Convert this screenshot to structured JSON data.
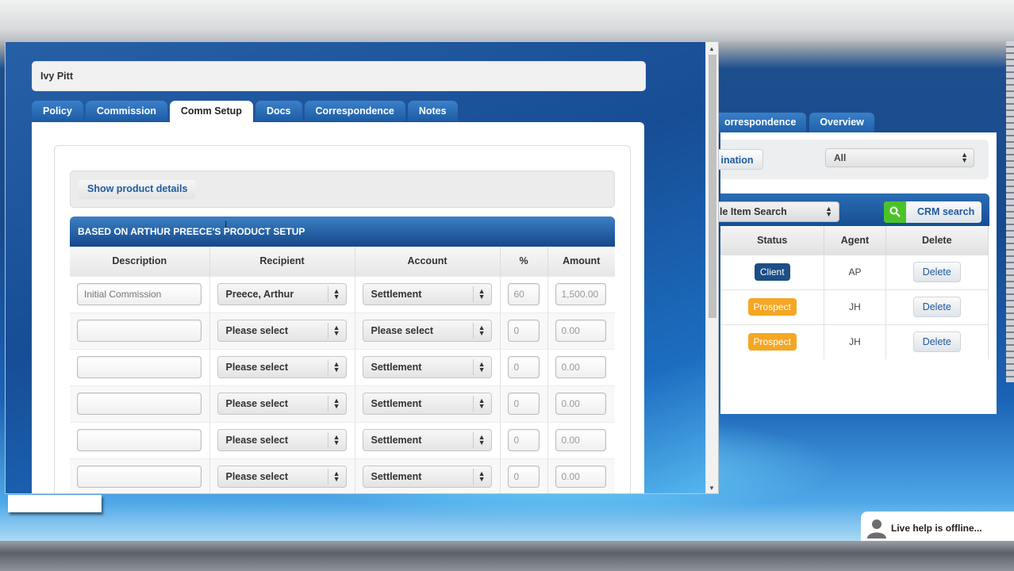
{
  "client_name": "Ivy Pitt",
  "tabs": [
    {
      "label": "Policy",
      "active": false
    },
    {
      "label": "Commission",
      "active": false
    },
    {
      "label": "Comm Setup",
      "active": true
    },
    {
      "label": "Docs",
      "active": false
    },
    {
      "label": "Correspondence",
      "active": false
    },
    {
      "label": "Notes",
      "active": false
    }
  ],
  "show_product_details_label": "Show product details",
  "setup_header": "BASED ON ARTHUR PREECE'S PRODUCT SETUP",
  "table": {
    "columns": [
      "Description",
      "Recipient",
      "Account",
      "%",
      "Amount"
    ],
    "rows": [
      {
        "description": "",
        "description_placeholder": "Initial Commission",
        "recipient": "Preece, Arthur",
        "account": "Settlement",
        "percent": "60",
        "amount": "1,500.00"
      },
      {
        "description": "",
        "description_placeholder": "",
        "recipient": "Please select",
        "account": "Please select",
        "percent": "0",
        "amount": "0.00"
      },
      {
        "description": "",
        "description_placeholder": "",
        "recipient": "Please select",
        "account": "Settlement",
        "percent": "0",
        "amount": "0.00"
      },
      {
        "description": "",
        "description_placeholder": "",
        "recipient": "Please select",
        "account": "Settlement",
        "percent": "0",
        "amount": "0.00"
      },
      {
        "description": "",
        "description_placeholder": "",
        "recipient": "Please select",
        "account": "Settlement",
        "percent": "0",
        "amount": "0.00"
      },
      {
        "description": "",
        "description_placeholder": "",
        "recipient": "Please select",
        "account": "Settlement",
        "percent": "0",
        "amount": "0.00"
      }
    ]
  },
  "background_app": {
    "tabs": [
      "orrespondence",
      "Overview"
    ],
    "filter_button": "ination",
    "filter_select": "All",
    "search_select": "le Item Search",
    "crm_search_label": "CRM search",
    "table_columns": [
      "Status",
      "Agent",
      "Delete"
    ],
    "rows": [
      {
        "status": "Client",
        "status_kind": "client",
        "agent": "AP",
        "delete": "Delete"
      },
      {
        "status": "Prospect",
        "status_kind": "prospect",
        "agent": "JH",
        "delete": "Delete"
      },
      {
        "status": "Prospect",
        "status_kind": "prospect",
        "agent": "JH",
        "delete": "Delete"
      }
    ]
  },
  "live_help_text": "Live help is offline...",
  "icons": {
    "crm_search": "search-icon",
    "live_help": "person-icon",
    "scroll_up": "arrow-up-icon",
    "scroll_down": "arrow-down-icon",
    "select_caret": "up-down-caret-icon"
  },
  "colors": {
    "tab_blue": "#1d5ca4",
    "link_blue": "#1e5a9e",
    "client_badge": "#1b4f86",
    "prospect_badge": "#f5a623",
    "crm_green": "#4cc22a"
  }
}
